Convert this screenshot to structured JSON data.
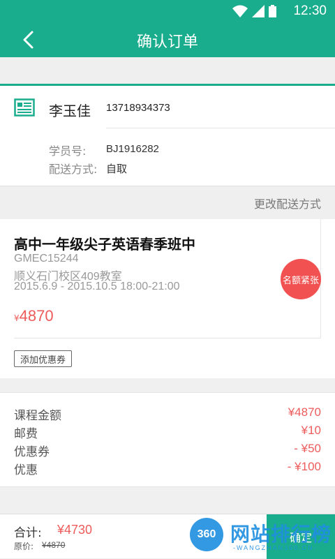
{
  "status_bar": {
    "time": "12:30"
  },
  "header": {
    "title": "确认订单",
    "back_icon": "back-arrow-icon"
  },
  "user": {
    "name": "李玉佳",
    "phone": "13718934373",
    "student_id_label": "学员号:",
    "student_id": "BJ1916282",
    "delivery_label": "配送方式:",
    "delivery_value": "自取"
  },
  "change_delivery_link": "更改配送方式",
  "course": {
    "title": "高中一年级尖子英语春季班中",
    "code": "GMEC15244",
    "location": "顺义石门校区409教室",
    "schedule": "2015.6.9 - 2015.10.5    18:00-21:00",
    "currency": "¥",
    "price": "4870",
    "badge": "名额紧张",
    "coupon_button": "添加优惠券"
  },
  "summary": {
    "rows": [
      {
        "label": "课程金额",
        "value": "¥4870"
      },
      {
        "label": "邮费",
        "value": "¥10"
      },
      {
        "label": "优惠券",
        "value": "- ¥50"
      },
      {
        "label": "优惠",
        "value": "- ¥100"
      }
    ]
  },
  "footer": {
    "total_label": "合计:",
    "total_value": "¥4730",
    "original_label": "原价:",
    "original_value": "¥4870",
    "confirm_label": "确定"
  },
  "watermark": {
    "logo": "360",
    "text": "网站排行榜",
    "sub": "-WANGZHAN360.CN-"
  },
  "colors": {
    "accent": "#1aad8d",
    "price": "#ee5b5b",
    "badge": "#f25151"
  }
}
